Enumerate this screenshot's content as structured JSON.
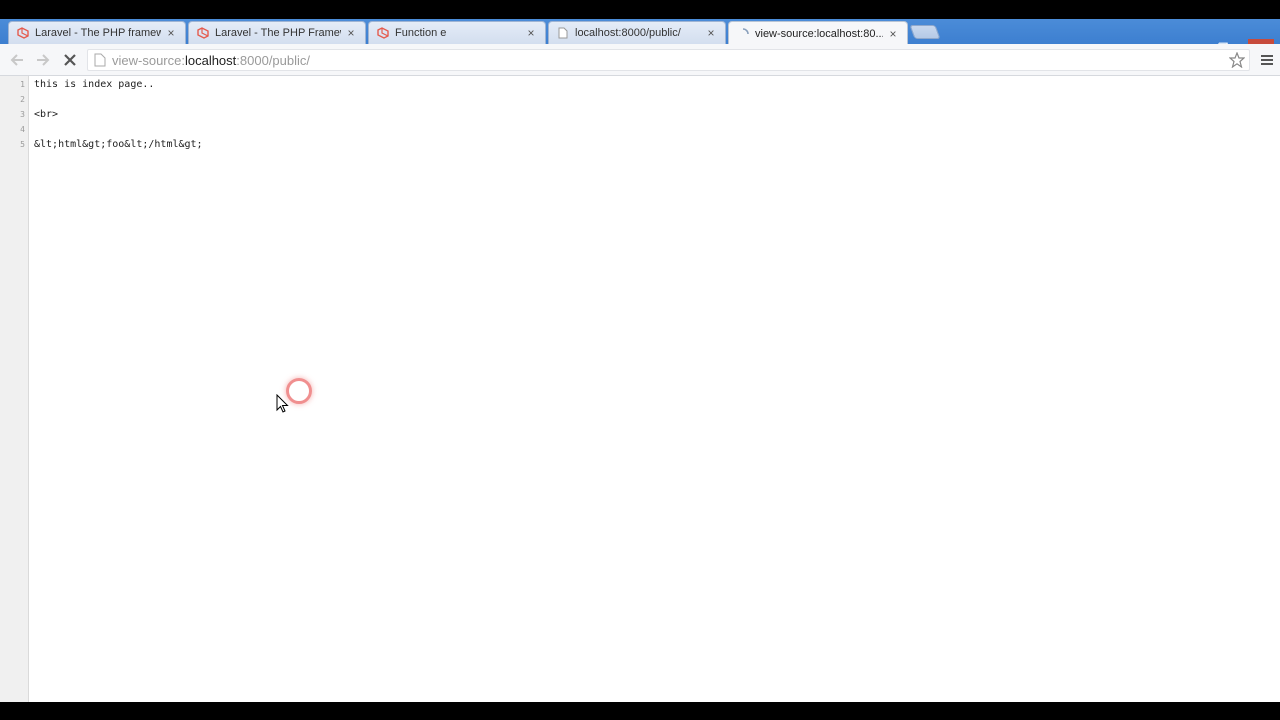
{
  "browser": {
    "tabs": [
      {
        "title": "Laravel - The PHP framew...",
        "favicon": "laravel-icon",
        "active": false
      },
      {
        "title": "Laravel - The PHP Framew...",
        "favicon": "laravel-icon",
        "active": false
      },
      {
        "title": "Function e",
        "favicon": "laravel-icon",
        "active": false
      },
      {
        "title": "localhost:8000/public/",
        "favicon": "page-icon",
        "active": false
      },
      {
        "title": "view-source:localhost:80...",
        "favicon": "loading-icon",
        "active": true
      }
    ],
    "tab_close_glyph": "×",
    "window_controls": {
      "minimize": "–",
      "restore": "❐",
      "close": "✕"
    }
  },
  "toolbar": {
    "url": {
      "scheme": "view-source:",
      "host": "localhost",
      "path": ":8000/public/"
    }
  },
  "source": {
    "lines": [
      {
        "num": "1",
        "code": "this is index page.."
      },
      {
        "num": "2",
        "code": ""
      },
      {
        "num": "3",
        "code": "<br>"
      },
      {
        "num": "4",
        "code": ""
      },
      {
        "num": "5",
        "code": "&lt;html&gt;foo&lt;/html&gt;"
      }
    ]
  },
  "colors": {
    "tabstrip": "#3d7fd0",
    "toolbar": "#f6f7f9",
    "click_indicator": "#f08f8f",
    "laravel_red": "#e55b4d"
  }
}
